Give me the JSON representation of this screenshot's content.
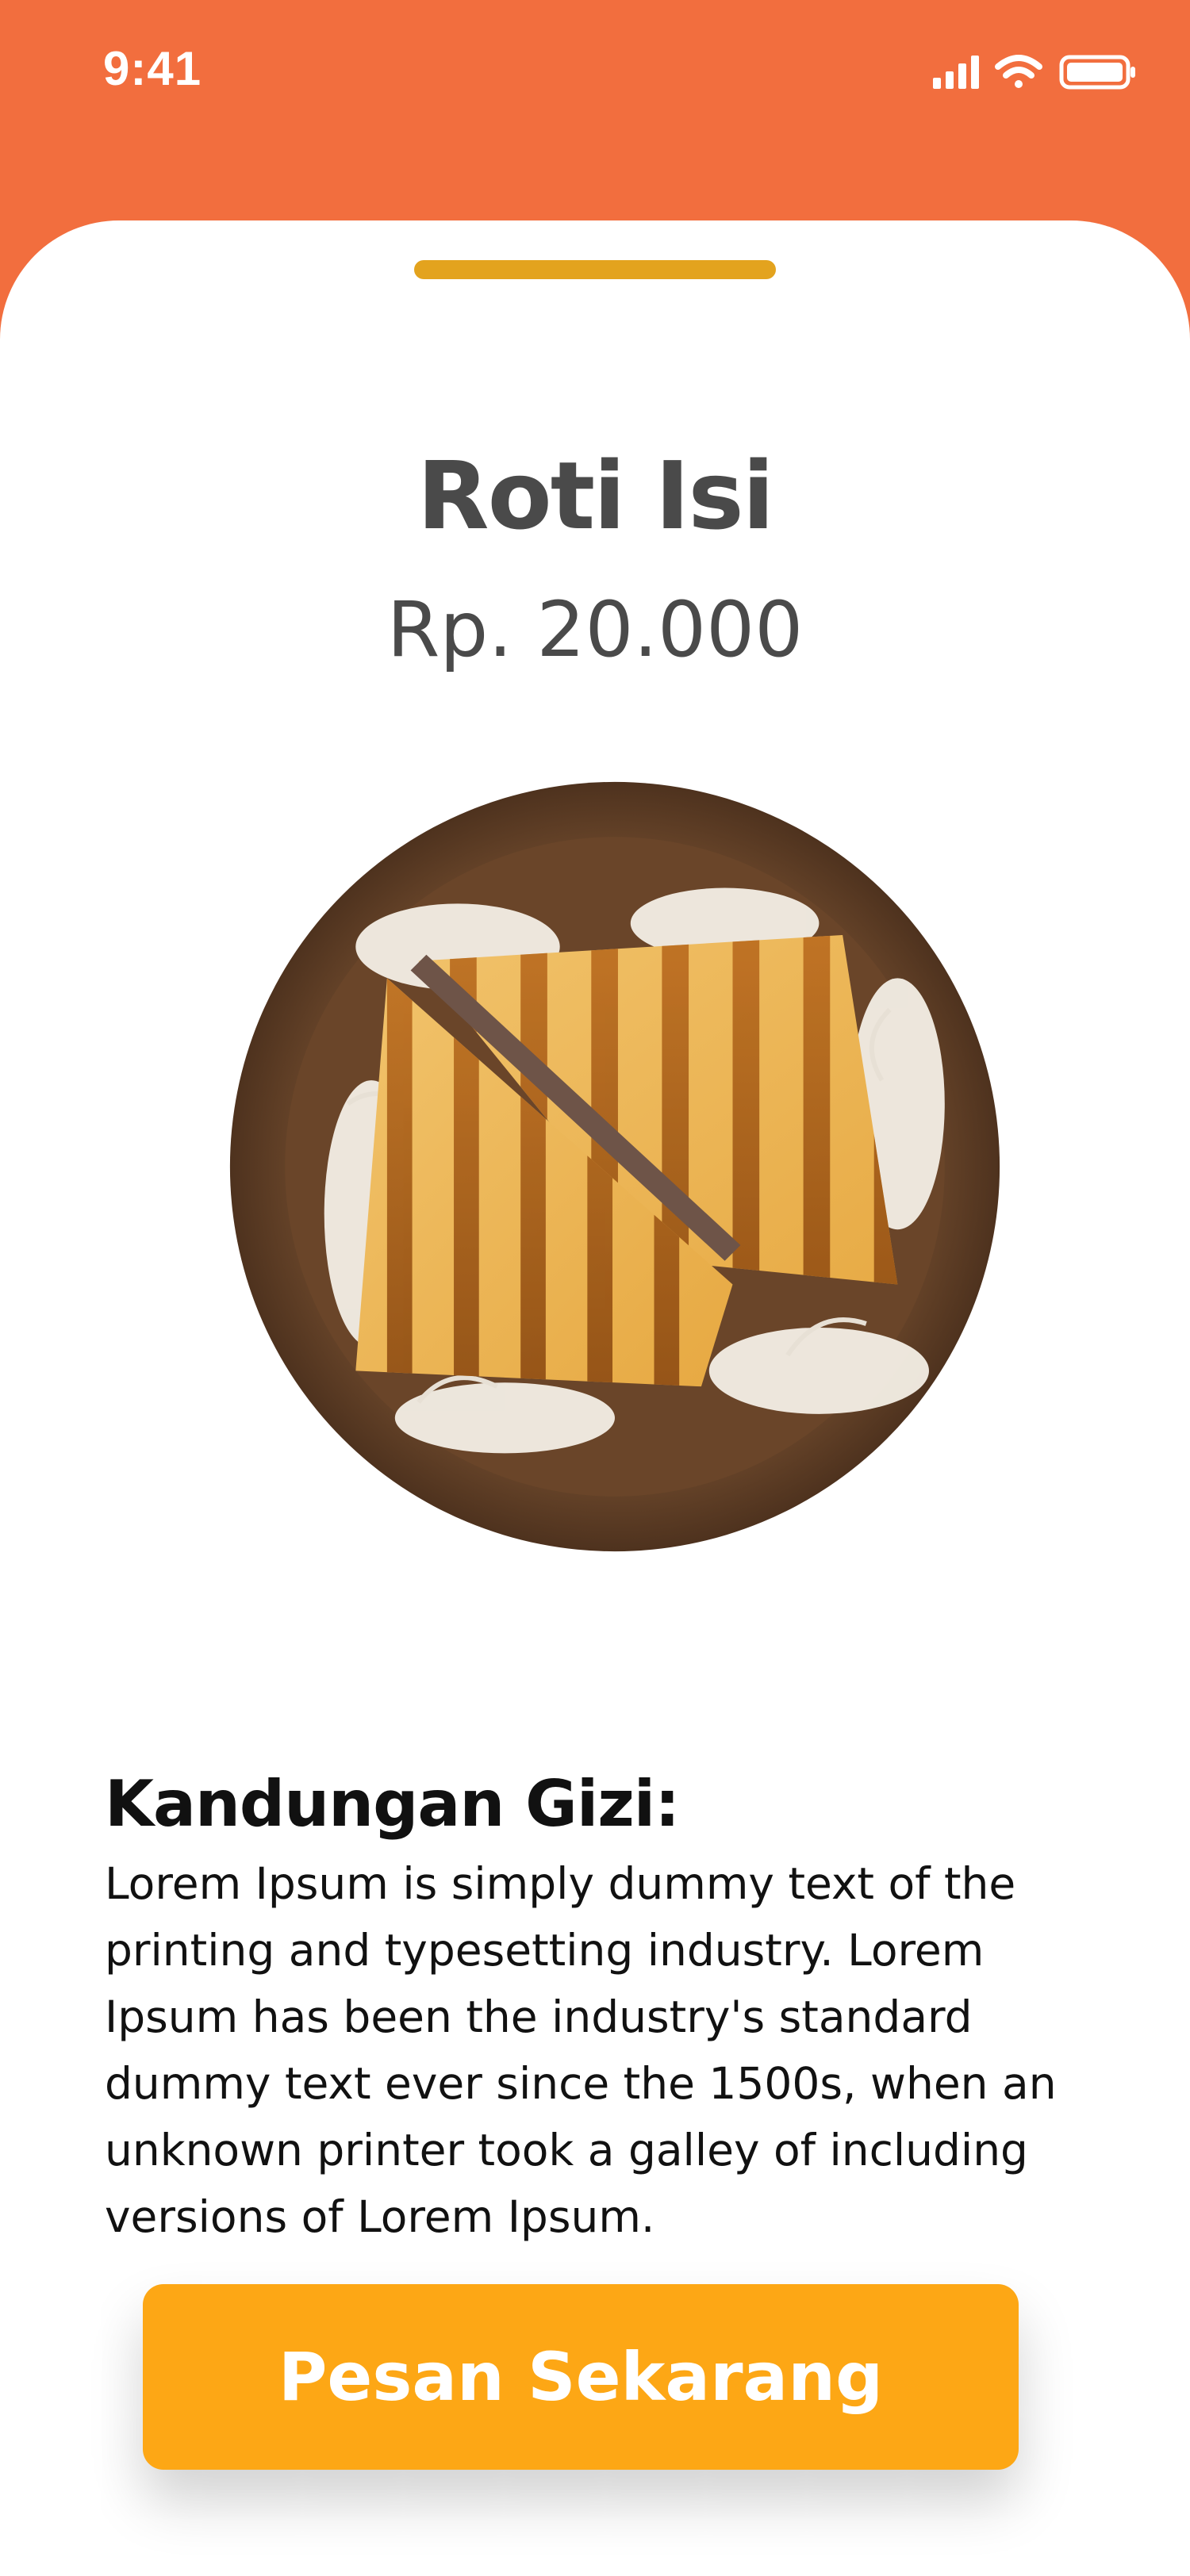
{
  "status_bar": {
    "time": "9:41",
    "icons": [
      "signal-icon",
      "wifi-icon",
      "battery-icon"
    ]
  },
  "product": {
    "name": "Roti Isi",
    "price": "Rp. 20.000",
    "image": "grilled-sandwich-on-plate"
  },
  "nutrition": {
    "heading": "Kandungan Gizi:",
    "text": "Lorem Ipsum is simply dummy text of the printing and typesetting industry. Lorem Ipsum has been the industry's standard dummy text ever since the 1500s, when an unknown printer took a galley of including versions of Lorem Ipsum."
  },
  "actions": {
    "order_label": "Pesan Sekarang"
  },
  "colors": {
    "header": "#F26E3E",
    "grabber": "#E3A31E",
    "button": "#FDA715",
    "text_dark": "#4A4A4A"
  }
}
